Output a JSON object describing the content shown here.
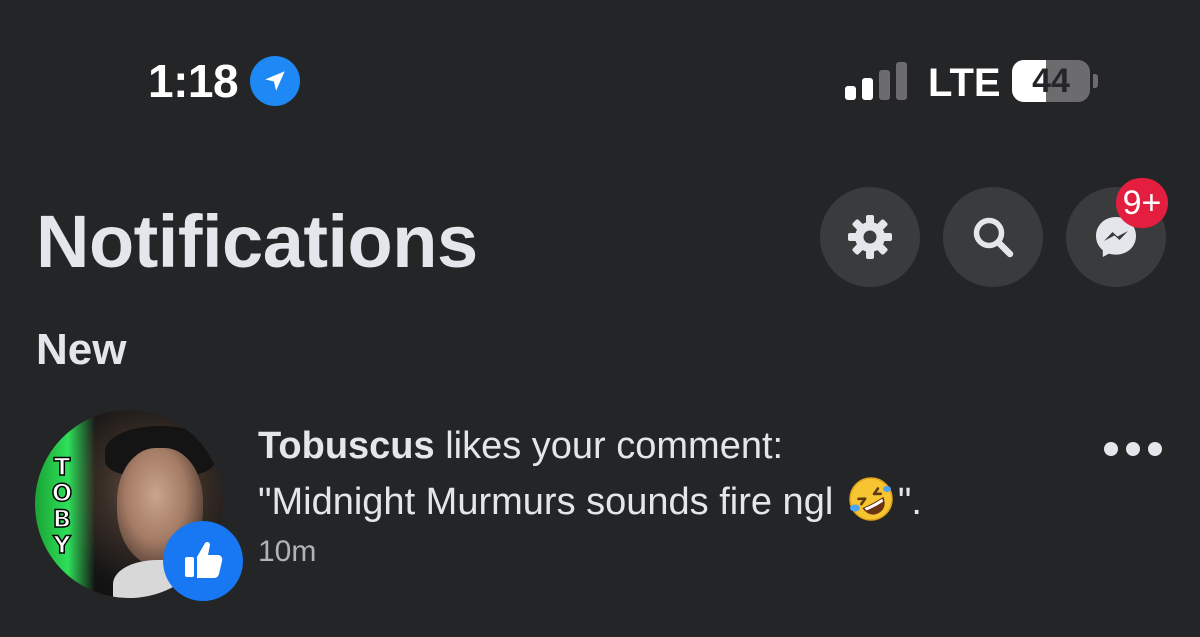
{
  "status_bar": {
    "time": "1:18",
    "location_icon": "location-arrow-icon",
    "signal_bars_active": 2,
    "signal_bars_total": 4,
    "network": "LTE",
    "battery_level": "44",
    "battery_fraction": 0.44
  },
  "header": {
    "title": "Notifications",
    "settings_icon": "gear-icon",
    "search_icon": "search-icon",
    "messenger_icon": "messenger-icon",
    "messenger_badge": "9+"
  },
  "section": {
    "heading": "New"
  },
  "notifications": [
    {
      "actor": "Tobuscus",
      "action": " likes your comment:",
      "quote_before": "\"Midnight Murmurs sounds fire ngl ",
      "emoji": "rolling-on-the-floor-laughing-emoji",
      "quote_after": "\".",
      "time": "10m",
      "avatar_logo": "TOBY",
      "reaction_icon": "thumbs-up-icon"
    }
  ],
  "colors": {
    "background": "#242526",
    "accent": "#1877f2",
    "badge": "#e41e3f",
    "primary_text": "#e4e6eb",
    "secondary_text": "#b0b3b8",
    "icon_button_bg": "#3a3b3c"
  }
}
